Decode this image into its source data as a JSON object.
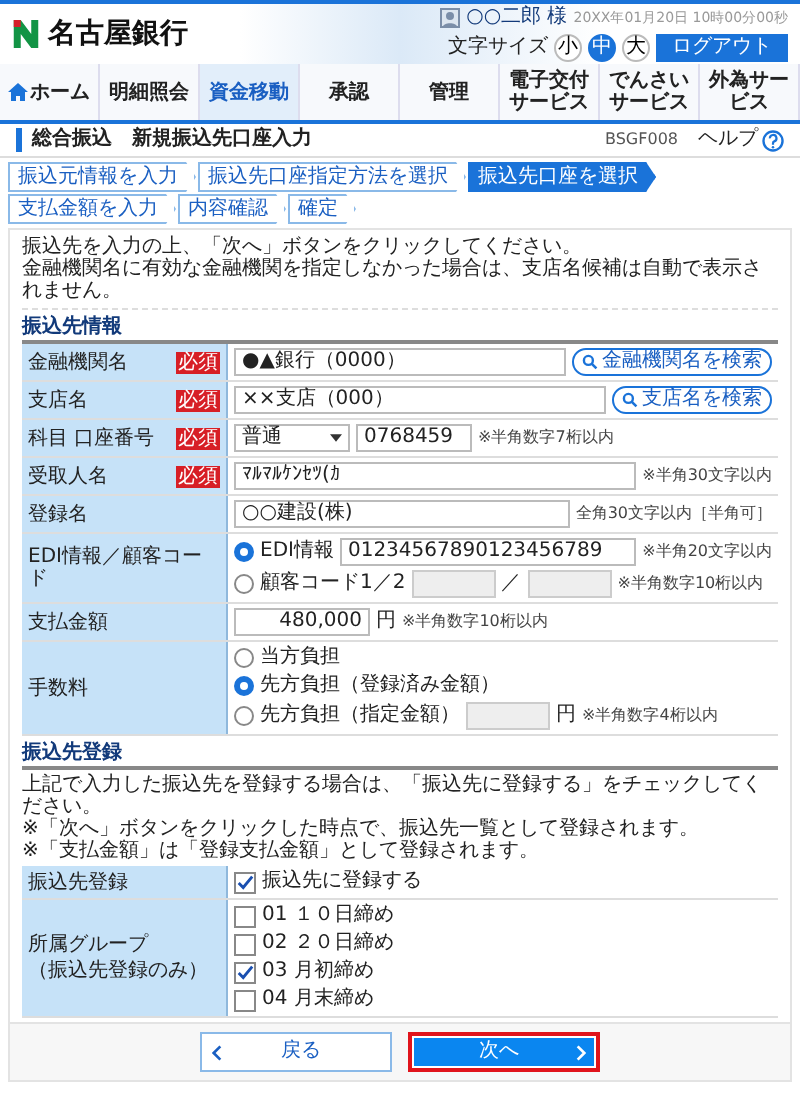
{
  "header": {
    "bank_name": "名古屋銀行",
    "user": "○○二郎 様",
    "datetime": "20XX年01月20日 10時00分00秒",
    "font_size_label": "文字サイズ",
    "font_sizes": [
      {
        "label": "小",
        "selected": false
      },
      {
        "label": "中",
        "selected": true
      },
      {
        "label": "大",
        "selected": false
      }
    ],
    "logout": "ログアウト"
  },
  "nav": [
    {
      "label": "ホーム",
      "kind": "home",
      "selected": false
    },
    {
      "label": "明細照会",
      "kind": "plain",
      "selected": false
    },
    {
      "label": "資金移動",
      "kind": "plain",
      "selected": true
    },
    {
      "label": "承認",
      "kind": "plain",
      "selected": false
    },
    {
      "label": "管理",
      "kind": "plain",
      "selected": false
    },
    {
      "label": "電子交付サービス",
      "kind": "plain",
      "selected": false
    },
    {
      "label": "でんさいサービス",
      "kind": "plain",
      "selected": false
    },
    {
      "label": "外為サービス",
      "kind": "plain",
      "selected": false
    }
  ],
  "page": {
    "category": "総合振込",
    "title": "新規振込先口座入力",
    "screen_id": "BSGF008",
    "help": "ヘルプ"
  },
  "steps": [
    {
      "label": "振込元情報を入力",
      "selected": false
    },
    {
      "label": "振込先口座指定方法を選択",
      "selected": false
    },
    {
      "label": "振込先口座を選択",
      "selected": true
    },
    {
      "label": "支払金額を入力",
      "selected": false
    },
    {
      "label": "内容確認",
      "selected": false
    },
    {
      "label": "確定",
      "selected": false
    }
  ],
  "instructions": [
    "振込先を入力の上、「次へ」ボタンをクリックしてください。",
    "金融機関名に有効な金融機関を指定しなかった場合は、支店名候補は自動で表示されません。"
  ],
  "recipient": {
    "title": "振込先情報",
    "rows": [
      {
        "kind": "search",
        "label": "金融機関名",
        "badge": "必須",
        "value": "●▲銀行（0000）",
        "button": "金融機関名を検索"
      },
      {
        "kind": "search",
        "label": "支店名",
        "badge": "必須",
        "value": "××支店（000）",
        "button": "支店名を検索"
      },
      {
        "kind": "account",
        "label": "科目 口座番号",
        "badge": "必須",
        "select": "普通",
        "value": "0768459",
        "hint": "※半角数字7桁以内"
      },
      {
        "kind": "text",
        "label": "受取人名",
        "badge": "必須",
        "value": "ﾏﾙﾏﾙｹﾝｾﾂ(ｶ",
        "hint": "※半角30文字以内"
      },
      {
        "kind": "text",
        "label": "登録名",
        "value": "○○建設(株)",
        "hint": "全角30文字以内［半角可］"
      },
      {
        "kind": "options",
        "label": "EDI情報／顧客コード",
        "options": [
          {
            "kind": "text",
            "label": "EDI情報",
            "selected": true,
            "value": "01234567890123456789",
            "hint": "※半角20文字以内",
            "disabled": false
          },
          {
            "kind": "pair",
            "label": "顧客コード1／2",
            "selected": false,
            "separator": "／",
            "hint": "※半角数字10桁以内",
            "disabled": true
          }
        ]
      },
      {
        "kind": "amount",
        "label": "支払金額",
        "value": "480,000",
        "unit": "円",
        "hint": "※半角数字10桁以内"
      },
      {
        "kind": "options",
        "label": "手数料",
        "options": [
          {
            "kind": "plain",
            "label": "当方負担",
            "selected": false
          },
          {
            "kind": "plain",
            "label": "先方負担（登録済み金額）",
            "selected": true
          },
          {
            "kind": "amount",
            "label": "先方負担（指定金額）",
            "selected": false,
            "unit": "円",
            "hint": "※半角数字4桁以内",
            "disabled": true
          }
        ]
      }
    ]
  },
  "registration": {
    "title": "振込先登録",
    "notes": [
      "上記で入力した振込先を登録する場合は、「振込先に登録する」をチェックしてください。",
      "※「次へ」ボタンをクリックした時点で、振込先一覧として登録されます。",
      "※「支払金額」は「登録支払金額」として登録されます。"
    ],
    "rows": [
      {
        "label": "振込先登録",
        "options": [
          {
            "label": "振込先に登録する",
            "checked": true
          }
        ]
      },
      {
        "label": "所属グループ",
        "sublabel": "（振込先登録のみ）",
        "options": [
          {
            "label": "01 １０日締め",
            "checked": false
          },
          {
            "label": "02 ２０日締め",
            "checked": false
          },
          {
            "label": "03 月初締め",
            "checked": true
          },
          {
            "label": "04 月末締め",
            "checked": false
          }
        ]
      }
    ]
  },
  "buttons": [
    {
      "label": "戻る",
      "kind": "back",
      "highlighted": false
    },
    {
      "label": "次へ",
      "kind": "next",
      "highlighted": true
    }
  ]
}
